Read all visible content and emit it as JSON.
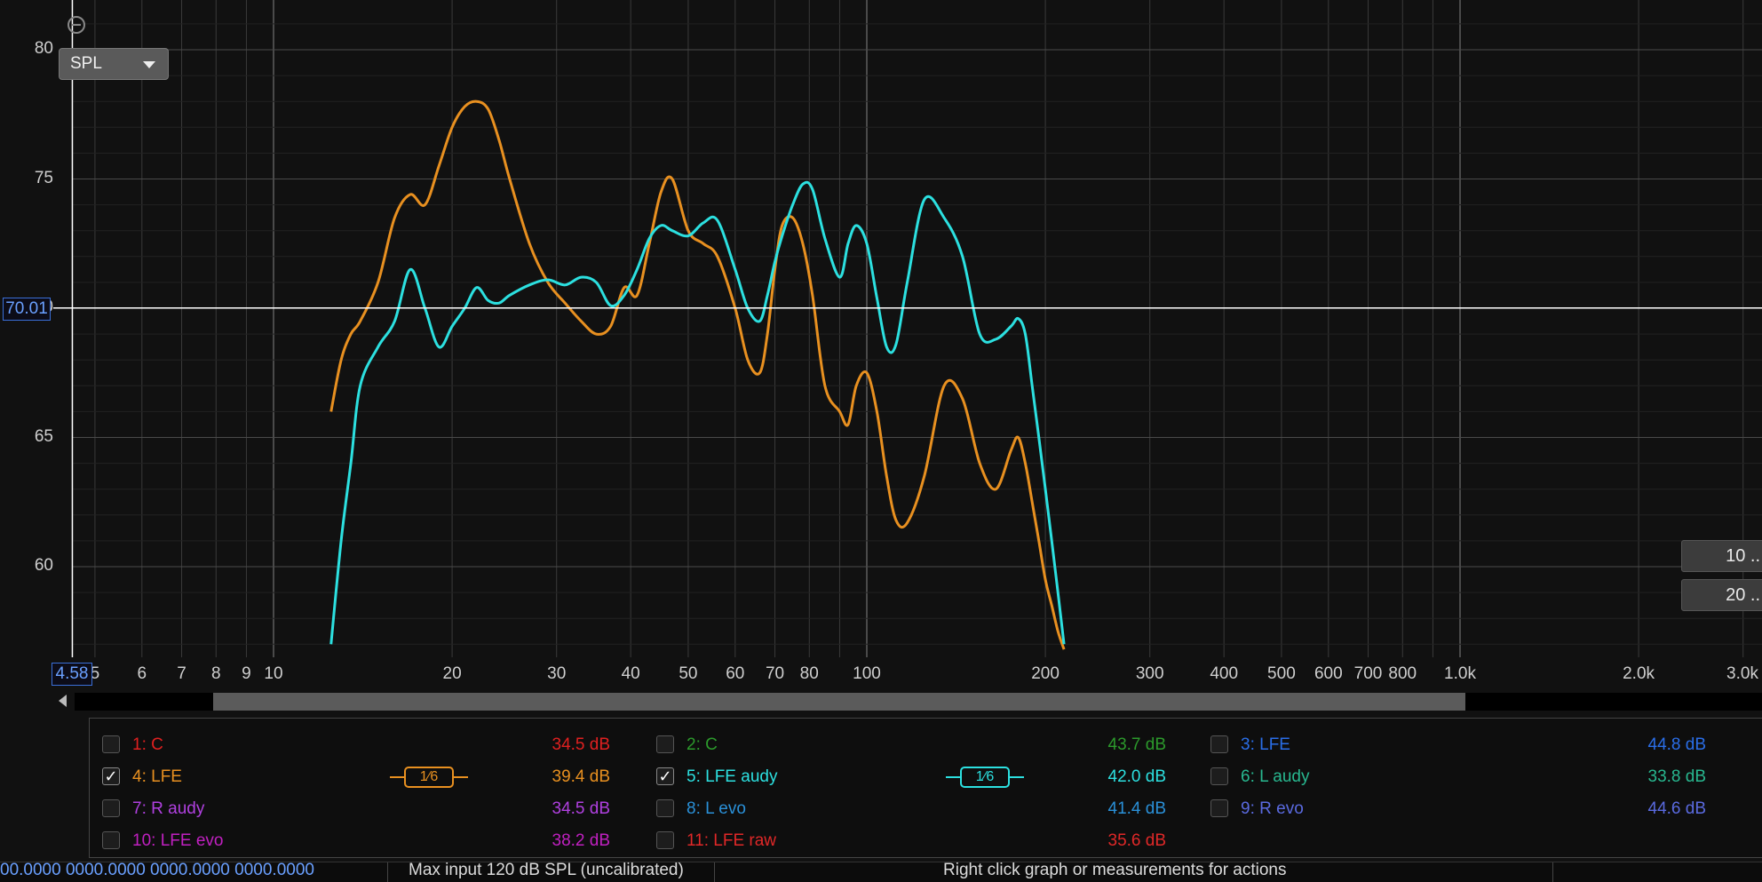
{
  "graph": {
    "measure_select": "SPL",
    "y_cursor_value": "70.01",
    "x_cursor_value": "4.58",
    "side_buttons": [
      "10 ..",
      "20 .."
    ],
    "y_ticks": [
      "80",
      "75",
      "70",
      "65",
      "60"
    ],
    "x_ticks": [
      "5",
      "6",
      "7",
      "8",
      "9",
      "10",
      "20",
      "30",
      "40",
      "50",
      "60",
      "70",
      "80",
      "100",
      "200",
      "300",
      "400",
      "500",
      "600",
      "700",
      "800",
      "1.0k",
      "2.0k",
      "3.0k"
    ],
    "colors": {
      "background": "#111111",
      "grid": "#3a3a3a",
      "cursor": "#ffffff",
      "lfe": "#e89020",
      "lfe_audy": "#2ce0e0"
    }
  },
  "chart_data": {
    "type": "line",
    "x_scale": "log",
    "xlim": [
      4.58,
      3000
    ],
    "ylim": [
      57,
      81.5
    ],
    "y_cursor": 70.01,
    "series": [
      {
        "name": "4: LFE",
        "color": "#e89020",
        "x": [
          12.5,
          13,
          13.5,
          14,
          15,
          16,
          17,
          18,
          19,
          20,
          21,
          22,
          23,
          24,
          25,
          27,
          29,
          31,
          33,
          35,
          37,
          39,
          41,
          43,
          45,
          47,
          50,
          53,
          56,
          60,
          63,
          66,
          68,
          70,
          72,
          75,
          78,
          81,
          85,
          90,
          93,
          96,
          100,
          104,
          108,
          112,
          117,
          125,
          135,
          145,
          155,
          165,
          175,
          180,
          185,
          190,
          195,
          200,
          205,
          210,
          215
        ],
        "y": [
          66,
          68,
          69,
          69.5,
          71,
          73.5,
          74.4,
          74,
          75.5,
          77,
          77.8,
          78,
          77.7,
          76.5,
          75,
          72.5,
          71,
          70.2,
          69.5,
          69,
          69.3,
          70.8,
          70.5,
          72.5,
          74.5,
          75,
          73,
          72.5,
          72,
          70,
          68,
          67.5,
          69,
          71.5,
          73.2,
          73.5,
          72.5,
          70.5,
          67,
          66,
          65.5,
          67,
          67.5,
          66,
          63.5,
          61.8,
          61.7,
          63.5,
          67,
          66.5,
          64,
          63,
          64.5,
          65,
          64,
          62.5,
          61,
          59.5,
          58.5,
          57.5,
          56.8
        ]
      },
      {
        "name": "5: LFE audy",
        "color": "#2ce0e0",
        "x": [
          12.5,
          13,
          13.5,
          14,
          15,
          16,
          17,
          18,
          19,
          20,
          21,
          22,
          23,
          24,
          25,
          27,
          29,
          31,
          33,
          35,
          37,
          39,
          41,
          43,
          45,
          47,
          50,
          53,
          56,
          60,
          63,
          66,
          68,
          70,
          72,
          75,
          78,
          81,
          85,
          90,
          93,
          96,
          100,
          104,
          108,
          112,
          117,
          125,
          135,
          145,
          155,
          165,
          175,
          180,
          185,
          190,
          195,
          200,
          205,
          210,
          215
        ],
        "y": [
          57,
          61,
          64,
          67,
          68.5,
          69.5,
          71.5,
          70,
          68.5,
          69.3,
          70,
          70.8,
          70.3,
          70.2,
          70.5,
          70.9,
          71.1,
          70.9,
          71.2,
          71,
          70.1,
          70.5,
          71.5,
          72.7,
          73.2,
          73,
          72.8,
          73.3,
          73.4,
          71.5,
          70,
          69.5,
          70.5,
          71.8,
          72.8,
          74,
          74.8,
          74.6,
          72.7,
          71.2,
          72.5,
          73.2,
          72.5,
          70.4,
          68.5,
          68.6,
          71,
          74.2,
          73.5,
          72,
          69,
          68.8,
          69.3,
          69.6,
          69,
          67,
          65,
          63,
          61,
          59,
          57
        ]
      }
    ]
  },
  "legend": {
    "items": [
      {
        "label": "1: C",
        "value": "34.5 dB",
        "checked": false,
        "color": "#e02020"
      },
      {
        "label": "2: C",
        "value": "43.7 dB",
        "checked": false,
        "color": "#2c9a2c"
      },
      {
        "label": "3: LFE",
        "value": "44.8 dB",
        "checked": false,
        "color": "#2a6ee8"
      },
      {
        "label": "4: LFE",
        "value": "39.4 dB",
        "checked": true,
        "color": "#e89020",
        "smoothing": "1⁄6"
      },
      {
        "label": "5: LFE audy",
        "value": "42.0 dB",
        "checked": true,
        "color": "#2ce0e0",
        "smoothing": "1⁄6"
      },
      {
        "label": "6: L audy",
        "value": "33.8 dB",
        "checked": false,
        "color": "#28b890"
      },
      {
        "label": "7: R audy",
        "value": "34.5 dB",
        "checked": false,
        "color": "#b040e0"
      },
      {
        "label": "8: L evo",
        "value": "41.4 dB",
        "checked": false,
        "color": "#2a90d8"
      },
      {
        "label": "9: R evo",
        "value": "44.6 dB",
        "checked": false,
        "color": "#5a6ae0"
      },
      {
        "label": "10: LFE evo",
        "value": "38.2 dB",
        "checked": false,
        "color": "#c020c0"
      },
      {
        "label": "11: LFE raw",
        "value": "35.6 dB",
        "checked": false,
        "color": "#e02828"
      }
    ]
  },
  "status_bar": {
    "cpu_text": "00.0000 0000.0000 0000.0000 0000.0000",
    "input_text": "Max input 120 dB SPL (uncalibrated)",
    "hint_text": "Right click graph or measurements for actions"
  }
}
